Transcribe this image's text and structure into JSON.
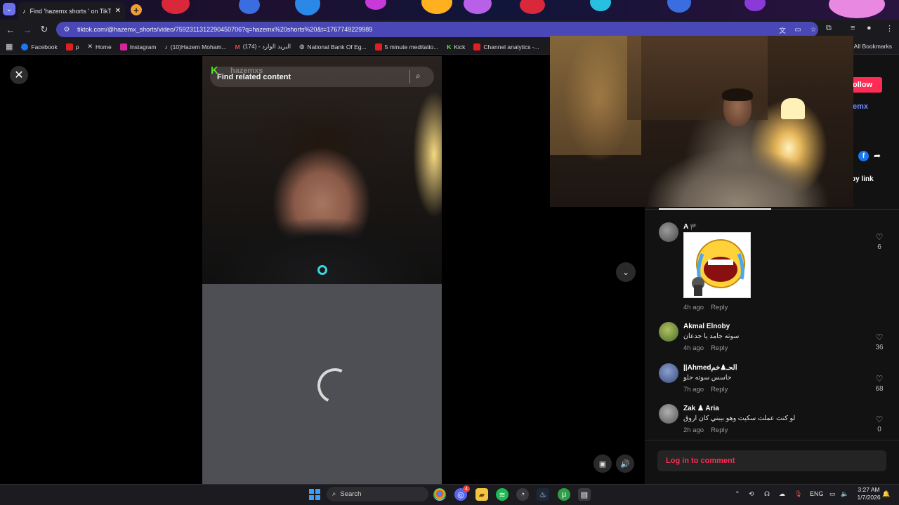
{
  "browser": {
    "tab_title": "Find 'hazemx shorts ' on TikTok",
    "url": "tiktok.com/@hazemx_shorts/video/7592311312290450706?q=hazemx%20shorts%20&t=1767749229989",
    "all_bookmarks": "All Bookmarks",
    "bookmarks": [
      {
        "label": "Facebook",
        "color": "#1877f2"
      },
      {
        "label": "p",
        "color": "#e02020"
      },
      {
        "label": "Home",
        "color": "#ffffff"
      },
      {
        "label": "Instagram",
        "color": "#d6249f"
      },
      {
        "label": "(10)Hazem Moham...",
        "color": "#ffffff"
      },
      {
        "label": "(174) - البريد الوارد",
        "color": "#ea4335"
      },
      {
        "label": "National Bank Of Eg...",
        "color": "#cfcfcf"
      },
      {
        "label": "5 minute meditatio...",
        "color": "#e02020"
      },
      {
        "label": "Kick",
        "color": "#53fc18"
      },
      {
        "label": "Channel analytics -...",
        "color": "#e02020"
      }
    ]
  },
  "page": {
    "search_placeholder": "Find related content",
    "watermark": "hazemxs",
    "follow_label": "ollow",
    "author_fragment": "emx",
    "copy_link": "py link",
    "login_prompt": "Log in to comment"
  },
  "comments": [
    {
      "user": "A",
      "badge": "🏴",
      "text": "",
      "time": "4h ago",
      "reply": "Reply",
      "likes": "6",
      "avatar_color": "#777777",
      "has_sticker": true
    },
    {
      "user": "Akmal Elnoby",
      "text": "سوته جامد يا جدعان",
      "time": "4h ago",
      "reply": "Reply",
      "likes": "36",
      "avatar_color": "#6b8f3a"
    },
    {
      "user": "||Ahmedالحـ♟خم",
      "text": "حاسس سوته حلو",
      "time": "7h ago",
      "reply": "Reply",
      "likes": "68",
      "avatar_color": "#5a6e9a"
    },
    {
      "user": "Zak ♟ Aria",
      "text": "لو كنت عملت سكيت وهو بيبني كان اروق",
      "time": "2h ago",
      "reply": "Reply",
      "likes": "0",
      "avatar_color": "#8a8a8a"
    }
  ],
  "taskbar": {
    "search_label": "Search",
    "lang": "ENG",
    "time": "3:27 AM",
    "date": "1/7/2026",
    "discord_badge": "4"
  }
}
